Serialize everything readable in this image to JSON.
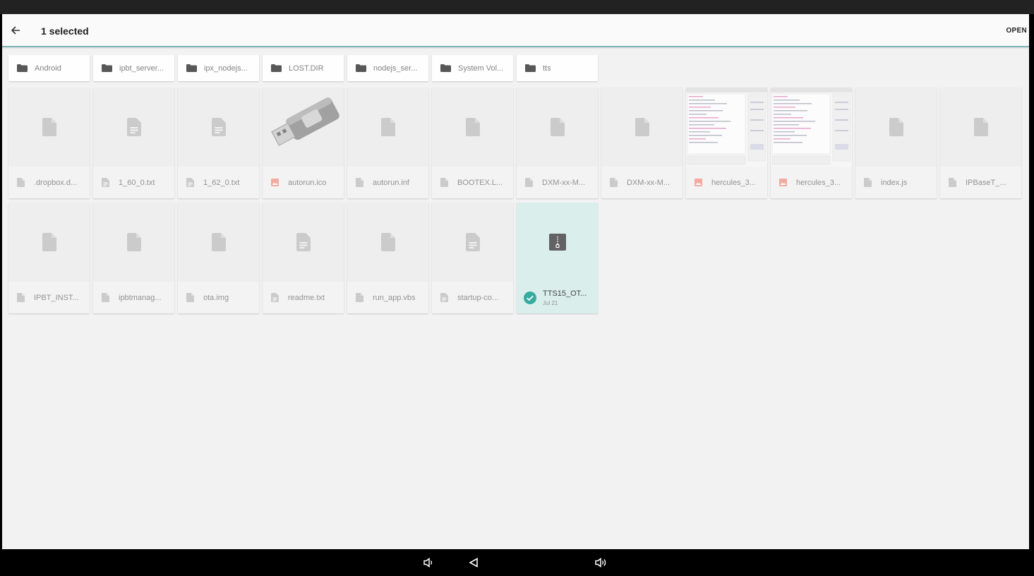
{
  "header": {
    "title": "1 selected",
    "open_label": "OPEN"
  },
  "folders": [
    {
      "name": "Android"
    },
    {
      "name": "ipbt_server..."
    },
    {
      "name": "ipx_nodejs..."
    },
    {
      "name": "LOST.DIR"
    },
    {
      "name": "nodejs_ser..."
    },
    {
      "name": "System Vol..."
    },
    {
      "name": "tts"
    }
  ],
  "files": [
    {
      "name": ".dropbox.d...",
      "icon": "generic-file-icon",
      "thumb": "generic"
    },
    {
      "name": "1_60_0.txt",
      "icon": "text-file-icon",
      "thumb": "text"
    },
    {
      "name": "1_62_0.txt",
      "icon": "text-file-icon",
      "thumb": "text"
    },
    {
      "name": "autorun.ico",
      "icon": "image-file-icon",
      "thumb": "usb"
    },
    {
      "name": "autorun.inf",
      "icon": "generic-file-icon",
      "thumb": "generic"
    },
    {
      "name": "BOOTEX.L...",
      "icon": "generic-file-icon",
      "thumb": "generic"
    },
    {
      "name": "DXM-xx-M...",
      "icon": "generic-file-icon",
      "thumb": "generic"
    },
    {
      "name": "DXM-xx-M...",
      "icon": "generic-file-icon",
      "thumb": "generic"
    },
    {
      "name": "hercules_3...",
      "icon": "image-file-icon",
      "thumb": "screenshot"
    },
    {
      "name": "hercules_3...",
      "icon": "image-file-icon",
      "thumb": "screenshot"
    },
    {
      "name": "index.js",
      "icon": "generic-file-icon",
      "thumb": "generic"
    },
    {
      "name": "IPBaseT_...",
      "icon": "generic-file-icon",
      "thumb": "generic"
    },
    {
      "name": "IPBT_INST...",
      "icon": "generic-file-icon",
      "thumb": "generic"
    },
    {
      "name": "ipbtmanag...",
      "icon": "generic-file-icon",
      "thumb": "generic"
    },
    {
      "name": "ota.img",
      "icon": "generic-file-icon",
      "thumb": "generic"
    },
    {
      "name": "readme.txt",
      "icon": "text-file-icon",
      "thumb": "text"
    },
    {
      "name": "run_app.vbs",
      "icon": "generic-file-icon",
      "thumb": "generic"
    },
    {
      "name": "startup-co...",
      "icon": "text-file-icon",
      "thumb": "text"
    },
    {
      "name": "TTS15_OT...",
      "icon": "zip-file-icon",
      "thumb": "zip",
      "selected": true,
      "date": "Jul 21"
    }
  ],
  "colors": {
    "accent": "#26a69a",
    "selected_bg": "#d8eeec",
    "image_icon": "#f4a49a",
    "icon_gray": "#c8c8c8"
  }
}
